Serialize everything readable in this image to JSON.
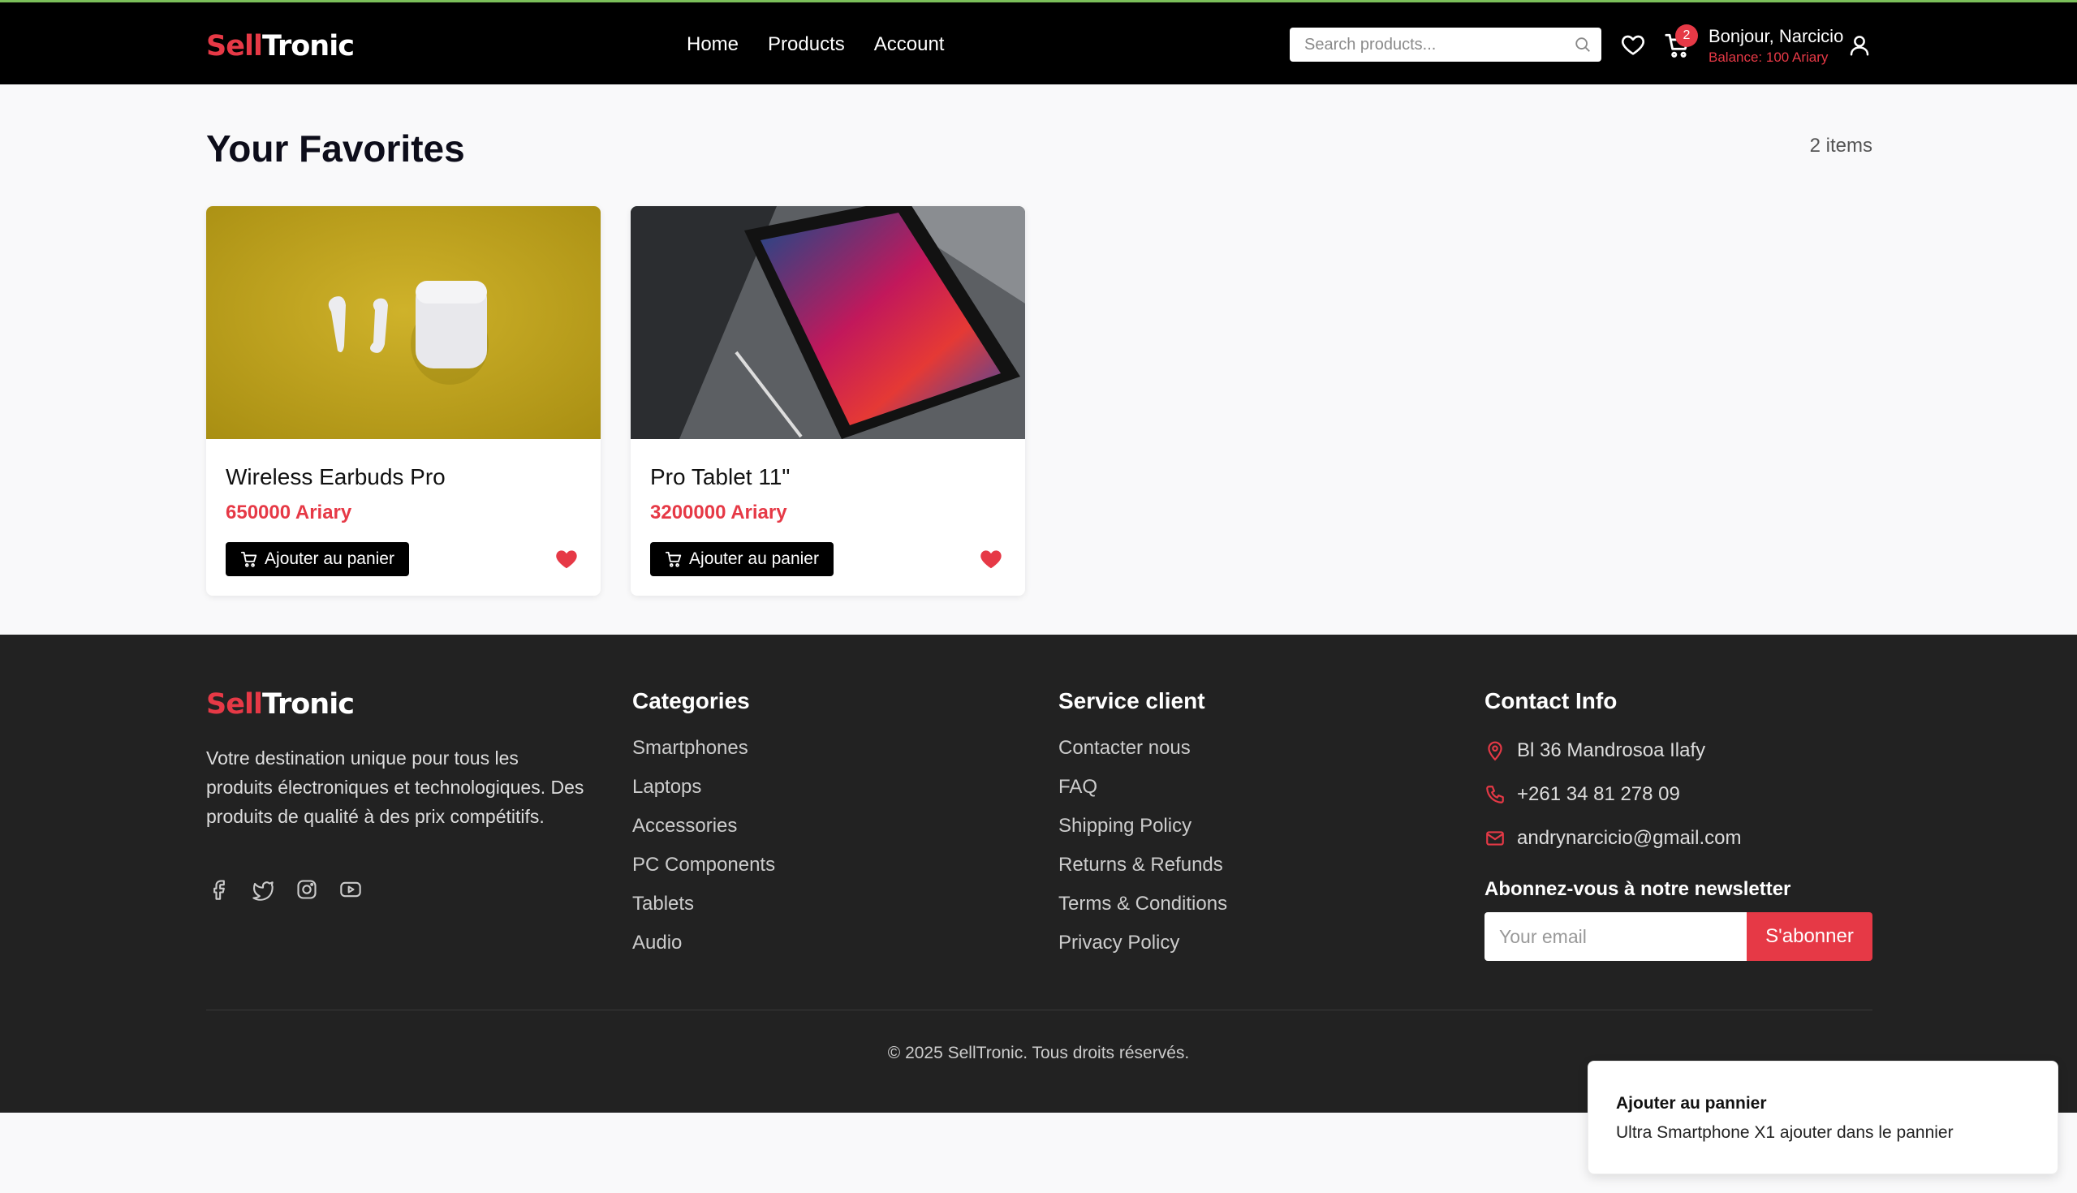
{
  "brand": {
    "part1": "Sell",
    "part2": "Tronic",
    "accent": "#e63946"
  },
  "header": {
    "nav": [
      "Home",
      "Products",
      "Account"
    ],
    "search_placeholder": "Search products...",
    "cart_count": "2",
    "greeting": "Bonjour, Narcicio",
    "balance": "Balance: 100 Ariary",
    "icons": [
      "search-icon",
      "heart-icon",
      "cart-icon",
      "user-icon"
    ]
  },
  "main": {
    "title": "Your Favorites",
    "count": "2 items",
    "products": [
      {
        "name": "Wireless Earbuds Pro",
        "price": "650000 Ariary",
        "button": "Ajouter au panier"
      },
      {
        "name": "Pro Tablet 11\"",
        "price": "3200000 Ariary",
        "button": "Ajouter au panier"
      }
    ]
  },
  "footer": {
    "description": "Votre destination unique pour tous les produits électroniques et technologiques. Des produits de qualité à des prix compétitifs.",
    "socials": [
      "facebook-icon",
      "twitter-icon",
      "instagram-icon",
      "youtube-icon"
    ],
    "categories": {
      "title": "Categories",
      "items": [
        "Smartphones",
        "Laptops",
        "Accessories",
        "PC Components",
        "Tablets",
        "Audio"
      ]
    },
    "service": {
      "title": "Service client",
      "items": [
        "Contacter nous",
        "FAQ",
        "Shipping Policy",
        "Returns & Refunds",
        "Terms & Conditions",
        "Privacy Policy"
      ]
    },
    "contact": {
      "title": "Contact Info",
      "address": "Bl 36 Mandrosoa Ilafy",
      "phone": "+261 34 81 278 09",
      "email": "andrynarcicio@gmail.com"
    },
    "newsletter": {
      "title": "Abonnez-vous à notre newsletter",
      "placeholder": "Your email",
      "button": "S'abonner"
    },
    "copyright": "© 2025 SellTronic. Tous droits réservés."
  },
  "toast": {
    "title": "Ajouter au pannier",
    "message": "Ultra Smartphone X1 ajouter dans le pannier"
  }
}
